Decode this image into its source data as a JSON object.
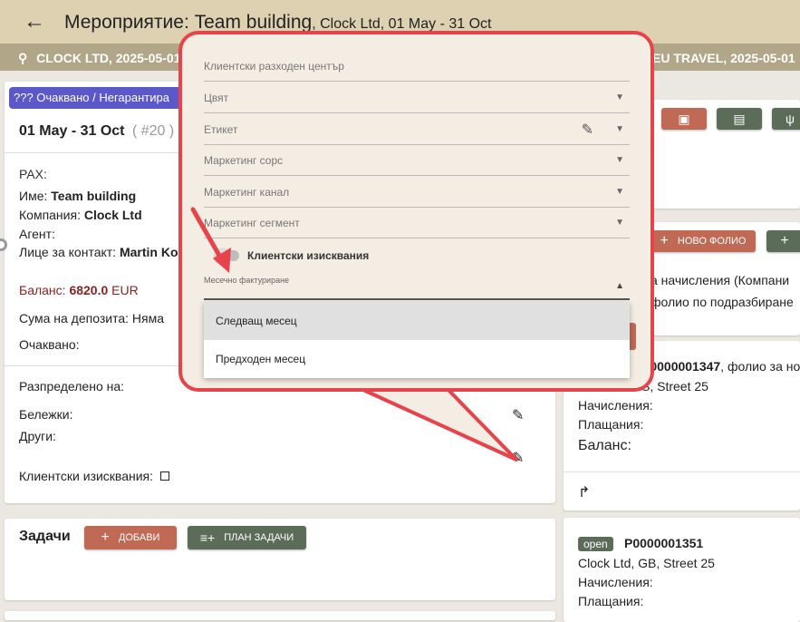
{
  "header": {
    "title": "Мероприятие: Team building",
    "subtitle": "Clock Ltd, 01 May - 31 Oct"
  },
  "strip": {
    "left_text": "CLOCK LTD, 2025-05-01",
    "right_text": "EU TRAVEL, 2025-05-01"
  },
  "event": {
    "status": "??? Очаквано / Негарантира",
    "dates": "01 May - 31 Oct",
    "number": "( #20 )",
    "pax_label": "PAX:",
    "name_label": "Име:",
    "name_value": "Team building",
    "company_label": "Компания:",
    "company_value": "Clock Ltd",
    "agent_label": "Агент:",
    "contact_label": "Лице за контакт:",
    "contact_value": "Martin Ko",
    "balance_label": "Баланс:",
    "balance_value": "6820.0",
    "balance_currency": "EUR",
    "deposit_label": "Сума на депозита: Няма",
    "expected_label": "Очаквано:",
    "allocated_label": "Разпределено на:",
    "notes_label": "Бележки:",
    "others_label": "Други:",
    "client_req_label": "Клиентски изисквания:"
  },
  "tasks": {
    "title": "Задачи",
    "add_label": "ДОБАВИ",
    "plan_label": "ПЛАН ЗАДАЧИ"
  },
  "right": {
    "new_folio_label": "НОВО ФОЛИО",
    "charges_text": "а начисления (Компани",
    "default_folio_text": "фолио по подразбиране",
    "folio1_number": "P0000001347",
    "folio1_suffix": ", фолио за но",
    "folio1_address": "S, Street 25",
    "charges_label": "Начисления:",
    "payments_label": "Плащания:",
    "balance_label": "Баланс:",
    "folio2_status": "open",
    "folio2_number": "P0000001351",
    "folio2_address": "Clock Ltd, GB, Street 25",
    "charges_label2": "Начисления:",
    "payments_label2": "Плащания:"
  },
  "popup": {
    "fields": [
      {
        "label": "Клиентски разходен център"
      },
      {
        "label": "Цвят"
      },
      {
        "label": "Етикет"
      },
      {
        "label": "Маркетинг сорс"
      },
      {
        "label": "Маркетинг канал"
      },
      {
        "label": "Маркетинг сегмент"
      }
    ],
    "toggle_label": "Клиентски изисквания",
    "monthly_label": "Месечно фактуриране",
    "options": [
      "Следващ месец",
      "Предходен месец"
    ]
  },
  "colors": {
    "accent_red": "#c06a56",
    "accent_green": "#5b6c58",
    "status_chip": "#5b58c9",
    "callout_border": "#e8424a"
  }
}
